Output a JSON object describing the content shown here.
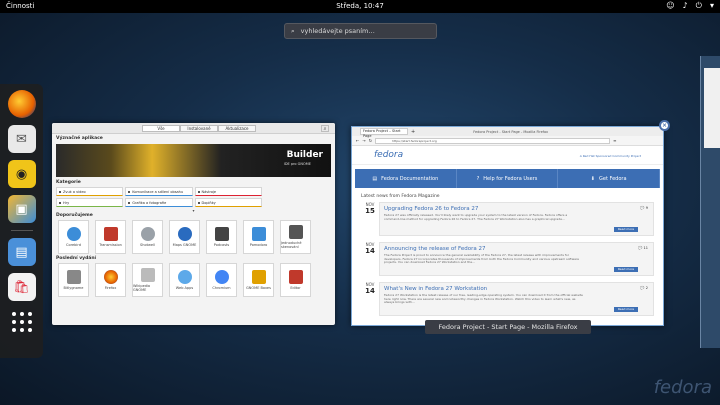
{
  "topbar": {
    "activities": "Činnosti",
    "clock": "Středa, 10:47",
    "tray_icons": [
      "accessibility-icon",
      "volume-icon",
      "power-icon",
      "chevron-down-icon"
    ]
  },
  "search": {
    "placeholder": "vyhledávejte psaním…"
  },
  "dash": {
    "apps": [
      "firefox-icon",
      "mail-icon",
      "speaker-icon",
      "photos-icon",
      "files-icon",
      "software-icon"
    ]
  },
  "software": {
    "tabs": [
      "Vše",
      "Instalované",
      "Aktualizace"
    ],
    "featured_label": "Význačné aplikace",
    "banner_title": "Builder",
    "banner_subtitle": "IDE pro GNOME",
    "categories_label": "Kategorie",
    "categories": [
      "Zvuk a video",
      "Komunikace a sdílení obsahu",
      "Nástroje",
      "Hry",
      "Grafika a fotografie",
      "Doplňky"
    ],
    "recommended_label": "Doporučujeme",
    "recommended": [
      "Corebird",
      "Transmission",
      "Shotwell",
      "Maps GNOME",
      "Podcasts",
      "Pomodoro",
      "Jednoduché skenování"
    ],
    "recent_label": "Poslední vydání",
    "recent": [
      "Bitlygnome",
      "Firefox",
      "Wikipedia GNOME",
      "Web Apps",
      "Chromium",
      "GNOME Boxes",
      "Editor"
    ]
  },
  "firefox": {
    "tab_label": "Fedora Project – Start Page",
    "window_title": "Fedora Project - Start Page - Mozilla Firefox",
    "url": "https://start.fedoraproject.org",
    "logo": "fedora",
    "project_link": "A Red Hat Sponsored Community Project",
    "nav": [
      "Fedora Documentation",
      "Help for Fedora Users",
      "Get Fedora"
    ],
    "latest_label": "Latest news from Fedora Magazine",
    "news": [
      {
        "month": "NOV",
        "day": "15",
        "title": "Upgrading Fedora 26 to Fedora 27",
        "text": "Fedora 27 was officially released. You'll likely want to upgrade your system to the latest version of Fedora. Fedora offers a command-line method for upgrading Fedora 26 to Fedora 27. The Fedora 27 Workstation also has a graphical upgrade...",
        "comments": "9",
        "more": "Read more"
      },
      {
        "month": "NOV",
        "day": "14",
        "title": "Announcing the release of Fedora 27",
        "text": "The Fedora Project is proud to announce the general availability of the Fedora 27, the latest release with improvements for developers. Fedora 27 incorporates thousands of improvements from both the Fedora Community and various upstream software projects. You can download Fedora 27 Workstation and the...",
        "comments": "11",
        "more": "Read more"
      },
      {
        "month": "NOV",
        "day": "14",
        "title": "What's New in Fedora 27 Workstation",
        "text": "Fedora 27 Workstation is the latest release of our free, leading-edge operating system. You can download it from the official website here right now. There are several new and noteworthy changes in Fedora Workstation. Watch this video to learn what's new, as always brings with...",
        "comments": "2",
        "more": "Read more"
      }
    ]
  },
  "watermark": "fedora"
}
